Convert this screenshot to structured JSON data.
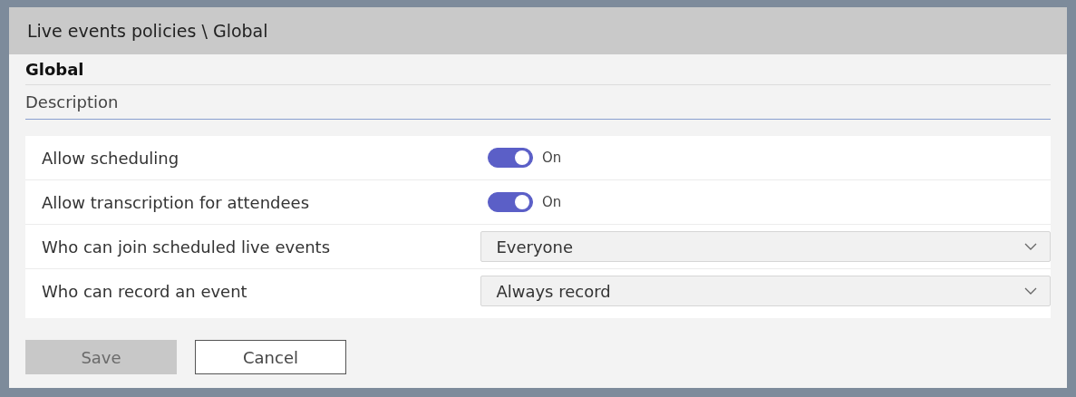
{
  "window": {
    "title": "Live events policies \\ Global"
  },
  "policy_name": "Global",
  "description_label": "Description",
  "settings": [
    {
      "kind": "toggle",
      "label": "Allow scheduling",
      "on": true,
      "state_label": "On"
    },
    {
      "kind": "toggle",
      "label": "Allow transcription for attendees",
      "on": true,
      "state_label": "On"
    },
    {
      "kind": "dropdown",
      "label": "Who can join scheduled live events",
      "value": "Everyone"
    },
    {
      "kind": "dropdown",
      "label": "Who can record an event",
      "value": "Always record"
    }
  ],
  "buttons": [
    {
      "label": "Save",
      "disabled": true
    },
    {
      "label": "Cancel",
      "disabled": false
    }
  ]
}
